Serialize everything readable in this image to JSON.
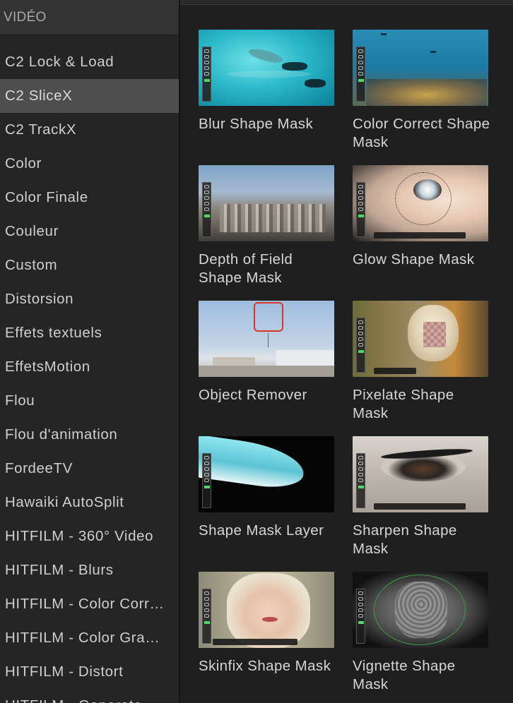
{
  "sidebar": {
    "header": "VIDÉO",
    "items": [
      "C2 Lock & Load",
      "C2 SliceX",
      "C2 TrackX",
      "Color",
      "Color Finale",
      "Couleur",
      "Custom",
      "Distorsion",
      "Effets textuels",
      "EffetsMotion",
      "Flou",
      "Flou d'animation",
      "FordeeTV",
      "Hawaiki AutoSplit",
      "HITFILM - 360° Video",
      "HITFILM - Blurs",
      "HITFILM - Color Corr…",
      "HITFILM - Color Gra…",
      "HITFILM - Distort",
      "HITFILM - Generate"
    ],
    "selected_index": 1
  },
  "effects": [
    {
      "label": "Blur Shape Mask"
    },
    {
      "label": "Color Correct Shape Mask"
    },
    {
      "label": "Depth of Field Shape Mask"
    },
    {
      "label": "Glow Shape Mask"
    },
    {
      "label": "Object Remover"
    },
    {
      "label": "Pixelate Shape Mask"
    },
    {
      "label": "Shape Mask Layer"
    },
    {
      "label": "Sharpen Shape Mask"
    },
    {
      "label": "Skinfix Shape Mask"
    },
    {
      "label": "Vignette Shape Mask"
    }
  ],
  "colors": {
    "sidebar_bg": "#252525",
    "header_bg": "#333333",
    "selected_bg": "#4e4e4e",
    "browser_bg": "#1f1f1f",
    "text": "#cfcfcf"
  }
}
